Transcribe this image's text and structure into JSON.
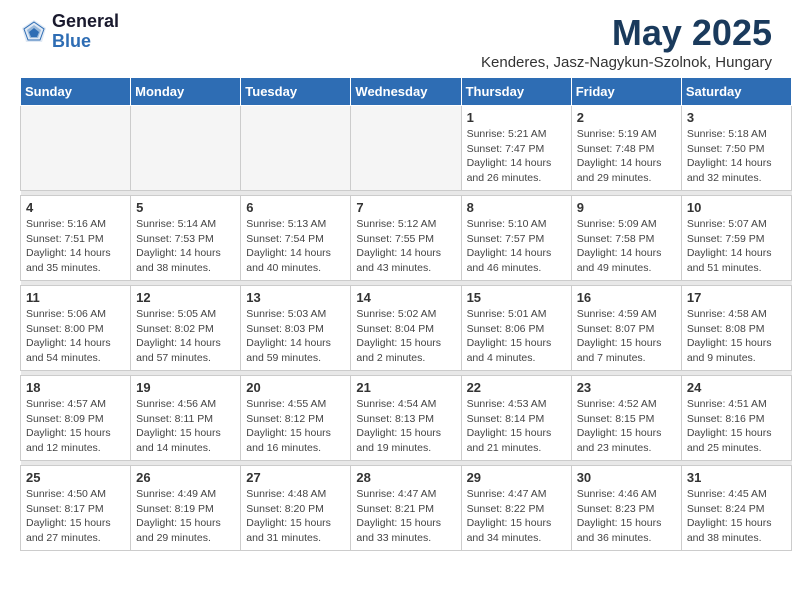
{
  "header": {
    "logo_general": "General",
    "logo_blue": "Blue",
    "month_title": "May 2025",
    "location": "Kenderes, Jasz-Nagykun-Szolnok, Hungary"
  },
  "weekdays": [
    "Sunday",
    "Monday",
    "Tuesday",
    "Wednesday",
    "Thursday",
    "Friday",
    "Saturday"
  ],
  "weeks": [
    [
      {
        "day": "",
        "info": ""
      },
      {
        "day": "",
        "info": ""
      },
      {
        "day": "",
        "info": ""
      },
      {
        "day": "",
        "info": ""
      },
      {
        "day": "1",
        "info": "Sunrise: 5:21 AM\nSunset: 7:47 PM\nDaylight: 14 hours and 26 minutes."
      },
      {
        "day": "2",
        "info": "Sunrise: 5:19 AM\nSunset: 7:48 PM\nDaylight: 14 hours and 29 minutes."
      },
      {
        "day": "3",
        "info": "Sunrise: 5:18 AM\nSunset: 7:50 PM\nDaylight: 14 hours and 32 minutes."
      }
    ],
    [
      {
        "day": "4",
        "info": "Sunrise: 5:16 AM\nSunset: 7:51 PM\nDaylight: 14 hours and 35 minutes."
      },
      {
        "day": "5",
        "info": "Sunrise: 5:14 AM\nSunset: 7:53 PM\nDaylight: 14 hours and 38 minutes."
      },
      {
        "day": "6",
        "info": "Sunrise: 5:13 AM\nSunset: 7:54 PM\nDaylight: 14 hours and 40 minutes."
      },
      {
        "day": "7",
        "info": "Sunrise: 5:12 AM\nSunset: 7:55 PM\nDaylight: 14 hours and 43 minutes."
      },
      {
        "day": "8",
        "info": "Sunrise: 5:10 AM\nSunset: 7:57 PM\nDaylight: 14 hours and 46 minutes."
      },
      {
        "day": "9",
        "info": "Sunrise: 5:09 AM\nSunset: 7:58 PM\nDaylight: 14 hours and 49 minutes."
      },
      {
        "day": "10",
        "info": "Sunrise: 5:07 AM\nSunset: 7:59 PM\nDaylight: 14 hours and 51 minutes."
      }
    ],
    [
      {
        "day": "11",
        "info": "Sunrise: 5:06 AM\nSunset: 8:00 PM\nDaylight: 14 hours and 54 minutes."
      },
      {
        "day": "12",
        "info": "Sunrise: 5:05 AM\nSunset: 8:02 PM\nDaylight: 14 hours and 57 minutes."
      },
      {
        "day": "13",
        "info": "Sunrise: 5:03 AM\nSunset: 8:03 PM\nDaylight: 14 hours and 59 minutes."
      },
      {
        "day": "14",
        "info": "Sunrise: 5:02 AM\nSunset: 8:04 PM\nDaylight: 15 hours and 2 minutes."
      },
      {
        "day": "15",
        "info": "Sunrise: 5:01 AM\nSunset: 8:06 PM\nDaylight: 15 hours and 4 minutes."
      },
      {
        "day": "16",
        "info": "Sunrise: 4:59 AM\nSunset: 8:07 PM\nDaylight: 15 hours and 7 minutes."
      },
      {
        "day": "17",
        "info": "Sunrise: 4:58 AM\nSunset: 8:08 PM\nDaylight: 15 hours and 9 minutes."
      }
    ],
    [
      {
        "day": "18",
        "info": "Sunrise: 4:57 AM\nSunset: 8:09 PM\nDaylight: 15 hours and 12 minutes."
      },
      {
        "day": "19",
        "info": "Sunrise: 4:56 AM\nSunset: 8:11 PM\nDaylight: 15 hours and 14 minutes."
      },
      {
        "day": "20",
        "info": "Sunrise: 4:55 AM\nSunset: 8:12 PM\nDaylight: 15 hours and 16 minutes."
      },
      {
        "day": "21",
        "info": "Sunrise: 4:54 AM\nSunset: 8:13 PM\nDaylight: 15 hours and 19 minutes."
      },
      {
        "day": "22",
        "info": "Sunrise: 4:53 AM\nSunset: 8:14 PM\nDaylight: 15 hours and 21 minutes."
      },
      {
        "day": "23",
        "info": "Sunrise: 4:52 AM\nSunset: 8:15 PM\nDaylight: 15 hours and 23 minutes."
      },
      {
        "day": "24",
        "info": "Sunrise: 4:51 AM\nSunset: 8:16 PM\nDaylight: 15 hours and 25 minutes."
      }
    ],
    [
      {
        "day": "25",
        "info": "Sunrise: 4:50 AM\nSunset: 8:17 PM\nDaylight: 15 hours and 27 minutes."
      },
      {
        "day": "26",
        "info": "Sunrise: 4:49 AM\nSunset: 8:19 PM\nDaylight: 15 hours and 29 minutes."
      },
      {
        "day": "27",
        "info": "Sunrise: 4:48 AM\nSunset: 8:20 PM\nDaylight: 15 hours and 31 minutes."
      },
      {
        "day": "28",
        "info": "Sunrise: 4:47 AM\nSunset: 8:21 PM\nDaylight: 15 hours and 33 minutes."
      },
      {
        "day": "29",
        "info": "Sunrise: 4:47 AM\nSunset: 8:22 PM\nDaylight: 15 hours and 34 minutes."
      },
      {
        "day": "30",
        "info": "Sunrise: 4:46 AM\nSunset: 8:23 PM\nDaylight: 15 hours and 36 minutes."
      },
      {
        "day": "31",
        "info": "Sunrise: 4:45 AM\nSunset: 8:24 PM\nDaylight: 15 hours and 38 minutes."
      }
    ]
  ]
}
